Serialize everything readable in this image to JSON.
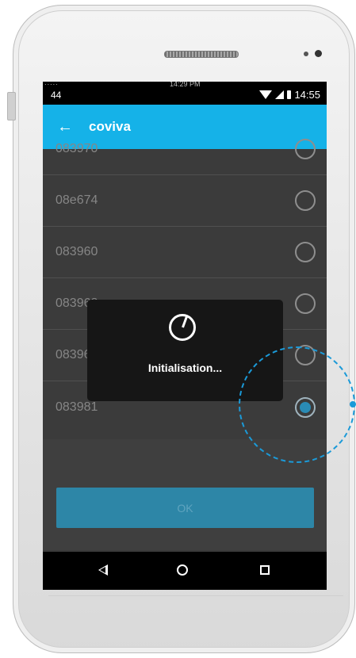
{
  "status_bar": {
    "left_text": "44",
    "ghost_dots": "∙∙∙∙∙",
    "ghost_time": "14:29 PM",
    "time": "14:55"
  },
  "app_bar": {
    "title": "coviva",
    "back_label": "←"
  },
  "list": {
    "items": [
      {
        "code": "083970",
        "selected": false
      },
      {
        "code": "08e674",
        "selected": false
      },
      {
        "code": "083960",
        "selected": false
      },
      {
        "code": "083968",
        "selected": false
      },
      {
        "code": "083965",
        "selected": false
      },
      {
        "code": "083981",
        "selected": true
      }
    ]
  },
  "ok_button": {
    "label": "OK"
  },
  "dialog": {
    "message": "Initialisation..."
  },
  "colors": {
    "appbar": "#15b2e8",
    "ok": "#2d86a7",
    "tap": "#1b9ad8"
  }
}
